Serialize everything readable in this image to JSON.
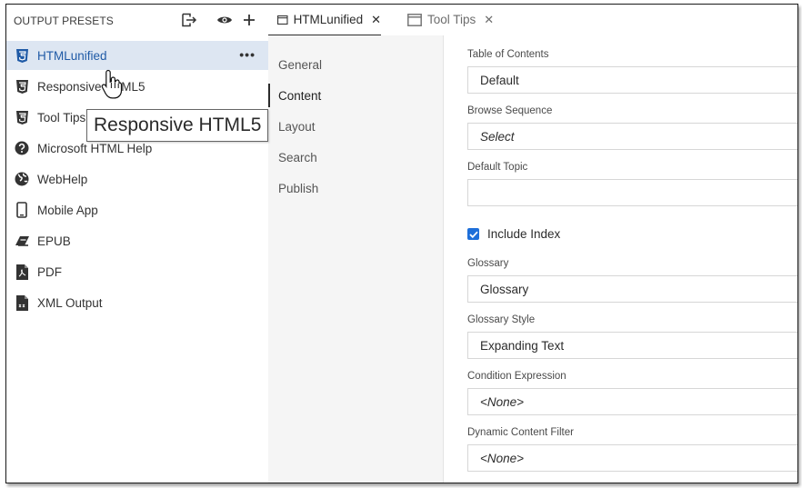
{
  "left_panel": {
    "title": "OUTPUT PRESETS",
    "header_icons": [
      "export-icon",
      "eye-icon",
      "plus-icon"
    ],
    "presets": [
      {
        "label": "HTMLunified",
        "icon": "html5-icon",
        "selected": true
      },
      {
        "label": "Responsive HTML5",
        "icon": "html5-icon",
        "selected": false
      },
      {
        "label": "Tool Tips",
        "icon": "html5-icon",
        "selected": false
      },
      {
        "label": "Microsoft HTML Help",
        "icon": "help-circle-icon",
        "selected": false
      },
      {
        "label": "WebHelp",
        "icon": "globe-icon",
        "selected": false
      },
      {
        "label": "Mobile App",
        "icon": "mobile-phone-icon",
        "selected": false
      },
      {
        "label": "EPUB",
        "icon": "epub-icon",
        "selected": false
      },
      {
        "label": "PDF",
        "icon": "pdf-file-icon",
        "selected": false
      },
      {
        "label": "XML Output",
        "icon": "xml-file-icon",
        "selected": false
      }
    ],
    "more_label": "•••"
  },
  "tabs": [
    {
      "label": "HTMLunified",
      "close": "✕",
      "active": true
    },
    {
      "label": "Tool Tips",
      "close": "✕",
      "active": false
    }
  ],
  "nav": {
    "items": [
      {
        "label": "General",
        "active": false
      },
      {
        "label": "Content",
        "active": true
      },
      {
        "label": "Layout",
        "active": false
      },
      {
        "label": "Search",
        "active": false
      },
      {
        "label": "Publish",
        "active": false
      }
    ]
  },
  "form": {
    "toc": {
      "label": "Table of Contents",
      "value": "Default"
    },
    "browse_sequence": {
      "label": "Browse Sequence",
      "value": "Select"
    },
    "default_topic": {
      "label": "Default Topic",
      "value": ""
    },
    "include_index": {
      "label": "Include Index",
      "checked": true
    },
    "glossary": {
      "label": "Glossary",
      "value": "Glossary"
    },
    "glossary_style": {
      "label": "Glossary Style",
      "value": "Expanding Text"
    },
    "condition_expression": {
      "label": "Condition Expression",
      "value": "<None>"
    },
    "dynamic_content_filter": {
      "label": "Dynamic Content Filter",
      "value": "<None>"
    }
  },
  "tooltip": {
    "text": "Responsive HTML5"
  },
  "colors": {
    "accent": "#1e6fd9",
    "selection": "#dde6f2",
    "link": "#1f5aa6"
  }
}
